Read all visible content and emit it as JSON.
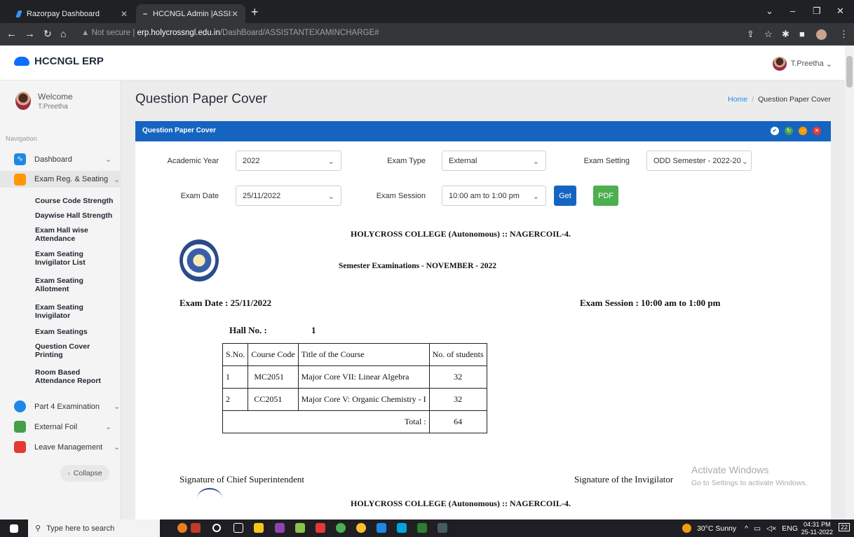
{
  "browser": {
    "tabs": [
      {
        "label": "Razorpay Dashboard"
      },
      {
        "label": "HCCNGL Admin |ASSISTANTEXAI"
      }
    ],
    "url": {
      "security": "Not secure",
      "host": "erp.holycrossngl.edu.in",
      "path": "/DashBoard/ASSISTANTEXAMINCHARGE#"
    }
  },
  "header": {
    "brand": "HCCNGL ERP",
    "user": "T.Preetha"
  },
  "sidebar": {
    "welcome": "Welcome",
    "user": "T.Preetha",
    "nav_label": "Navigation",
    "items": [
      {
        "label": "Dashboard",
        "icon": "pulse-icon",
        "color": "#1e88e5"
      },
      {
        "label": "Exam Reg. & Seating",
        "icon": "book-icon",
        "color": "#ff9800"
      },
      {
        "label": "Part 4 Examination",
        "icon": "circle-icon",
        "color": "#1e88e5"
      },
      {
        "label": "External Foil",
        "icon": "form-icon",
        "color": "#43a047"
      },
      {
        "label": "Leave Management",
        "icon": "calendar-icon",
        "color": "#e53935"
      }
    ],
    "subitems": [
      "Course Code Strength",
      "Daywise Hall Strength",
      "Exam Hall wise Attendance",
      "Exam Seating Invigilator List",
      "Exam Seating Allotment",
      "Exam Seating Invigilator",
      "Exam Seatings",
      "Question Cover Printing",
      "Room Based Attendance Report"
    ],
    "collapse": "Collapse"
  },
  "page": {
    "title": "Question Paper Cover",
    "breadcrumb": {
      "home": "Home",
      "current": "Question Paper Cover"
    },
    "panel_title": "Question Paper Cover"
  },
  "form": {
    "academic_year": {
      "label": "Academic Year",
      "value": "2022"
    },
    "exam_type": {
      "label": "Exam Type",
      "value": "External"
    },
    "exam_setting": {
      "label": "Exam Setting",
      "value": "ODD Semester - 2022-20..."
    },
    "exam_date": {
      "label": "Exam Date",
      "value": "25/11/2022"
    },
    "exam_session": {
      "label": "Exam Session",
      "value": "10:00 am to 1:00 pm"
    },
    "get_button": "Get",
    "pdf_button": "PDF"
  },
  "document": {
    "college": "HOLYCROSS COLLEGE (Autonomous) :: NAGERCOIL-4.",
    "exam_title": "Semester Examinations - NOVEMBER - 2022",
    "exam_date": "Exam Date : 25/11/2022",
    "exam_session": "Exam Session : 10:00 am to 1:00 pm",
    "hall_label": "Hall No. :",
    "hall_no": "1",
    "columns": [
      "S.No.",
      "Course Code",
      "Title of the Course",
      "No. of students"
    ],
    "rows": [
      [
        "1",
        "MC2051",
        "Major Core VII: Linear Algebra",
        "32"
      ],
      [
        "2",
        "CC2051",
        "Major Core V: Organic Chemistry - I",
        "32"
      ]
    ],
    "total_label": "Total :",
    "total_value": "64",
    "sig_chief": "Signature of Chief Superintendent",
    "sig_invigilator": "Signature of the Invigilator",
    "college_repeat": "HOLYCROSS COLLEGE (Autonomous) :: NAGERCOIL-4."
  },
  "watermark": {
    "line1": "Activate Windows",
    "line2": "Go to Settings to activate Windows."
  },
  "taskbar": {
    "search_placeholder": "Type here to search",
    "weather": "30°C  Sunny",
    "lang": "ENG",
    "time": "04:31 PM",
    "date": "25-11-2022",
    "notifications": "22"
  }
}
